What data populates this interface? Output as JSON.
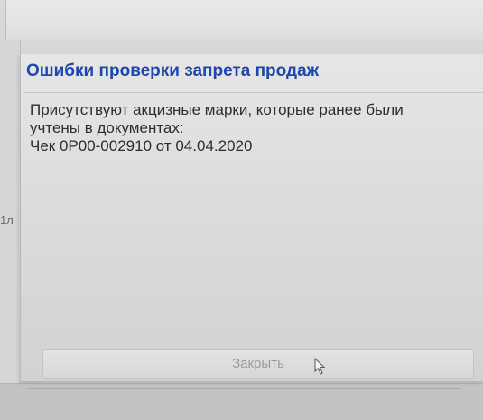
{
  "dialog": {
    "title": "Ошибки проверки запрета продаж",
    "message_lines": [
      "Присутствуют акцизные марки, которые ранее были",
      "учтены в документах:",
      "Чек 0Р00-002910 от 04.04.2020"
    ],
    "close_label": "Закрыть"
  },
  "background": {
    "left_label": "1л"
  },
  "colors": {
    "title": "#1d46b0",
    "text": "#2d2d2d",
    "button_text": "#9a9a98"
  },
  "icons": {
    "cursor": "mouse-pointer-icon"
  }
}
